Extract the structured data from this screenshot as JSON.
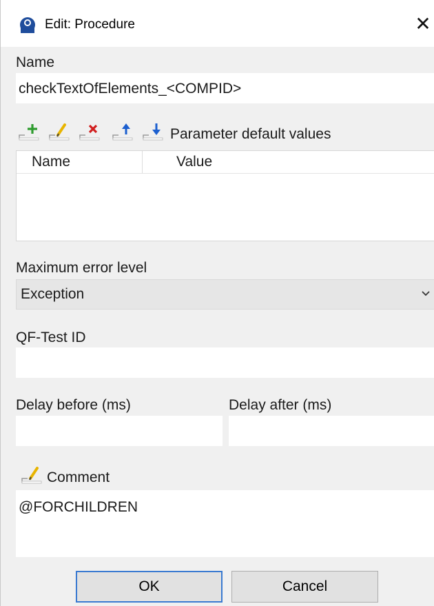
{
  "window": {
    "title": "Edit: Procedure",
    "close_symbol": "✕"
  },
  "name_field": {
    "label": "Name",
    "value": "checkTextOfElements_<COMPID>"
  },
  "parameters": {
    "label": "Parameter default values",
    "toolbar": [
      "add-icon",
      "edit-icon",
      "delete-icon",
      "move-up-icon",
      "move-down-icon"
    ],
    "columns": [
      "Name",
      "Value"
    ],
    "rows": []
  },
  "error_level": {
    "label": "Maximum error level",
    "selected": "Exception"
  },
  "qftest_id": {
    "label": "QF-Test ID",
    "value": ""
  },
  "delay_before": {
    "label": "Delay before (ms)",
    "value": ""
  },
  "delay_after": {
    "label": "Delay after (ms)",
    "value": ""
  },
  "comment": {
    "label": "Comment",
    "value": "@FORCHILDREN"
  },
  "buttons": {
    "ok": "OK",
    "cancel": "Cancel"
  },
  "colors": {
    "add": "#2e9b2e",
    "edit": "#e8b400",
    "delete": "#d11f1f",
    "move": "#1c5fcf",
    "focus": "#3a7ad1"
  }
}
